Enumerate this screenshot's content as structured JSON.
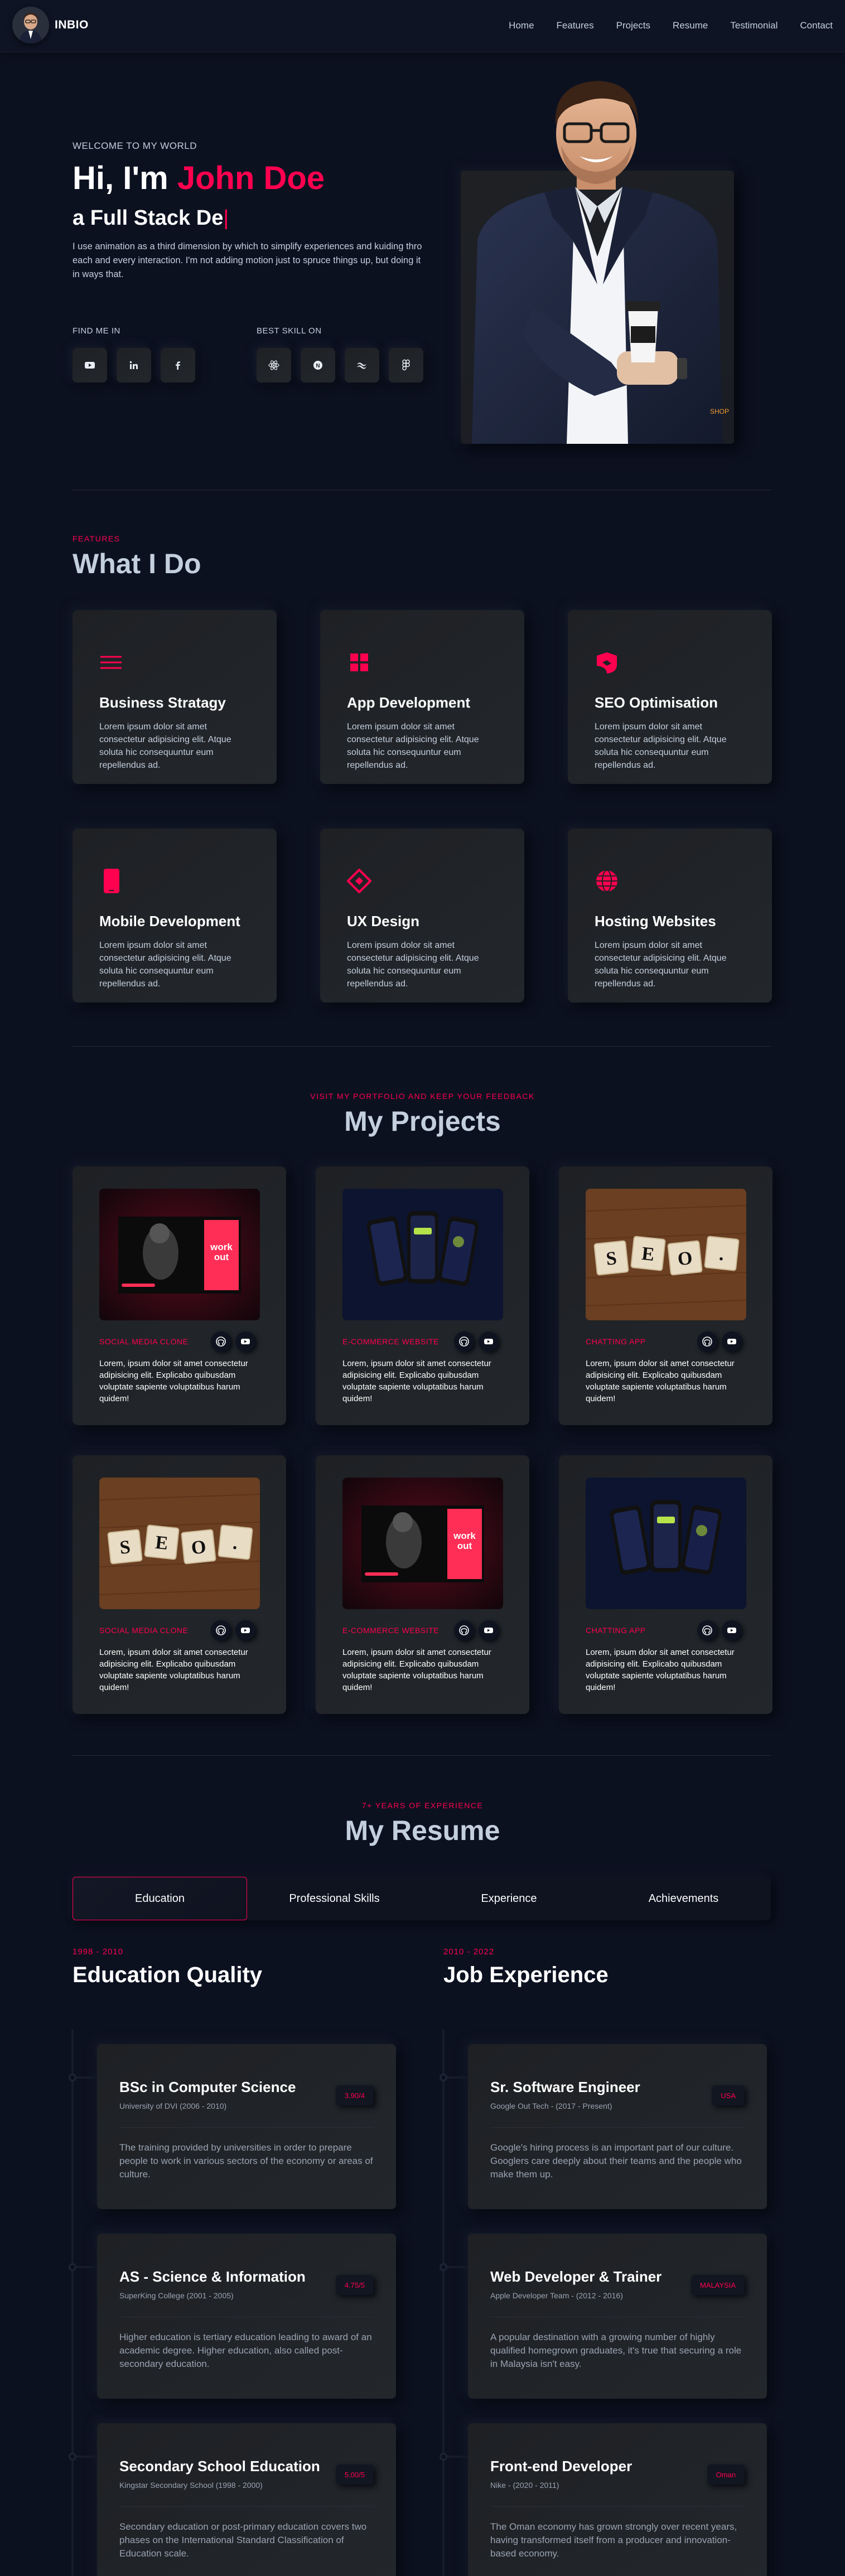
{
  "header": {
    "logo_text": "INBIO",
    "nav": [
      "Home",
      "Features",
      "Projects",
      "Resume",
      "Testimonial",
      "Contact"
    ]
  },
  "hero": {
    "welcome": "WELCOME TO MY WORLD",
    "greeting": "Hi, I'm ",
    "name": "John Doe",
    "subtitle": "a Full Stack De",
    "cursor": "|",
    "description": "I use animation as a third dimension by which to simplify experiences and kuiding thro each and every interaction. I'm not adding motion just to spruce things up, but doing it in ways that.",
    "find_me_label": "FIND ME IN",
    "best_skill_label": "BEST SKILL ON",
    "social_icons": [
      "youtube-icon",
      "linkedin-icon",
      "facebook-icon"
    ],
    "skill_icons": [
      "react-icon",
      "node-icon",
      "tailwind-icon",
      "figma-icon"
    ],
    "cup_label": "SHOP"
  },
  "features": {
    "kicker": "Features",
    "title": "What I Do",
    "items": [
      {
        "icon": "menu-lines-icon",
        "title": "Business Stratagy",
        "desc": "Lorem ipsum dolor sit amet consectetur adipisicing elit. Atque soluta hic consequuntur eum repellendus ad."
      },
      {
        "icon": "grid-icon",
        "title": "App Development",
        "desc": "Lorem ipsum dolor sit amet consectetur adipisicing elit. Atque soluta hic consequuntur eum repellendus ad."
      },
      {
        "icon": "seo-chart-icon",
        "title": "SEO Optimisation",
        "desc": "Lorem ipsum dolor sit amet consectetur adipisicing elit. Atque soluta hic consequuntur eum repellendus ad."
      },
      {
        "icon": "mobile-phone-icon",
        "title": "Mobile Development",
        "desc": "Lorem ipsum dolor sit amet consectetur adipisicing elit. Atque soluta hic consequuntur eum repellendus ad."
      },
      {
        "icon": "diamond-icon",
        "title": "UX Design",
        "desc": "Lorem ipsum dolor sit amet consectetur adipisicing elit. Atque soluta hic consequuntur eum repellendus ad."
      },
      {
        "icon": "globe-icon",
        "title": "Hosting Websites",
        "desc": "Lorem ipsum dolor sit amet consectetur adipisicing elit. Atque soluta hic consequuntur eum repellendus ad."
      }
    ]
  },
  "projects": {
    "kicker": "VISIT MY PORTFOLIO AND KEEP YOUR FEEDBACK",
    "title": "My Projects",
    "items": [
      {
        "thumb": "workout",
        "category": "SOCIAL MEDIA CLONE",
        "desc": "Lorem, ipsum dolor sit amet consectetur adipisicing elit. Explicabo quibusdam voluptate sapiente voluptatibus harum quidem!"
      },
      {
        "thumb": "phones",
        "category": "E-COMMERCE WEBSITE",
        "desc": "Lorem, ipsum dolor sit amet consectetur adipisicing elit. Explicabo quibusdam voluptate sapiente voluptatibus harum quidem!"
      },
      {
        "thumb": "seo",
        "category": "CHATTING APP",
        "desc": "Lorem, ipsum dolor sit amet consectetur adipisicing elit. Explicabo quibusdam voluptate sapiente voluptatibus harum quidem!"
      },
      {
        "thumb": "seo",
        "category": "SOCIAL MEDIA CLONE",
        "desc": "Lorem, ipsum dolor sit amet consectetur adipisicing elit. Explicabo quibusdam voluptate sapiente voluptatibus harum quidem!"
      },
      {
        "thumb": "workout",
        "category": "E-COMMERCE WEBSITE",
        "desc": "Lorem, ipsum dolor sit amet consectetur adipisicing elit. Explicabo quibusdam voluptate sapiente voluptatibus harum quidem!"
      },
      {
        "thumb": "phones",
        "category": "CHATTING APP",
        "desc": "Lorem, ipsum dolor sit amet consectetur adipisicing elit. Explicabo quibusdam voluptate sapiente voluptatibus harum quidem!"
      }
    ],
    "thumb_text": {
      "workout": "work out",
      "seo": [
        "S",
        "E",
        "O",
        "."
      ]
    }
  },
  "resume": {
    "kicker": "7+ YEARS OF EXPERIENCE",
    "title": "My Resume",
    "tabs": [
      "Education",
      "Professional Skills",
      "Experience",
      "Achievements"
    ],
    "active_tab": "Education",
    "education": {
      "years": "1998 - 2010",
      "heading": "Education Quality",
      "items": [
        {
          "title": "BSc in Computer Science",
          "meta": "University of DVI (2006 - 2010)",
          "badge": "3.90/4",
          "desc": "The training provided by universities in order to prepare people to work in various sectors of the economy or areas of culture."
        },
        {
          "title": "AS - Science & Information",
          "meta": "SuperKing College (2001 - 2005)",
          "badge": "4.75/5",
          "desc": "Higher education is tertiary education leading to award of an academic degree. Higher education, also called post-secondary education."
        },
        {
          "title": "Secondary School Education",
          "meta": "Kingstar Secondary School (1998 - 2000)",
          "badge": "5.00/5",
          "desc": "Secondary education or post-primary education covers two phases on the International Standard Classification of Education scale."
        }
      ]
    },
    "experience": {
      "years": "2010 - 2022",
      "heading": "Job Experience",
      "items": [
        {
          "title": "Sr. Software Engineer",
          "meta": "Google Out Tech - (2017 - Present)",
          "badge": "USA",
          "desc": "Google's hiring process is an important part of our culture. Googlers care deeply about their teams and the people who make them up."
        },
        {
          "title": "Web Developer & Trainer",
          "meta": "Apple Developer Team - (2012 - 2016)",
          "badge": "MALAYSIA",
          "desc": "A popular destination with a growing number of highly qualified homegrown graduates, it's true that securing a role in Malaysia isn't easy."
        },
        {
          "title": "Front-end Developer",
          "meta": "Nike - (2020 - 2011)",
          "badge": "Oman",
          "desc": "The Oman economy has grown strongly over recent years, having transformed itself from a producer and innovation-based economy."
        }
      ]
    }
  },
  "colors": {
    "accent": "#ff014f",
    "background": "#0c1120",
    "card": "#1e2024",
    "text": "#c4cfde"
  }
}
